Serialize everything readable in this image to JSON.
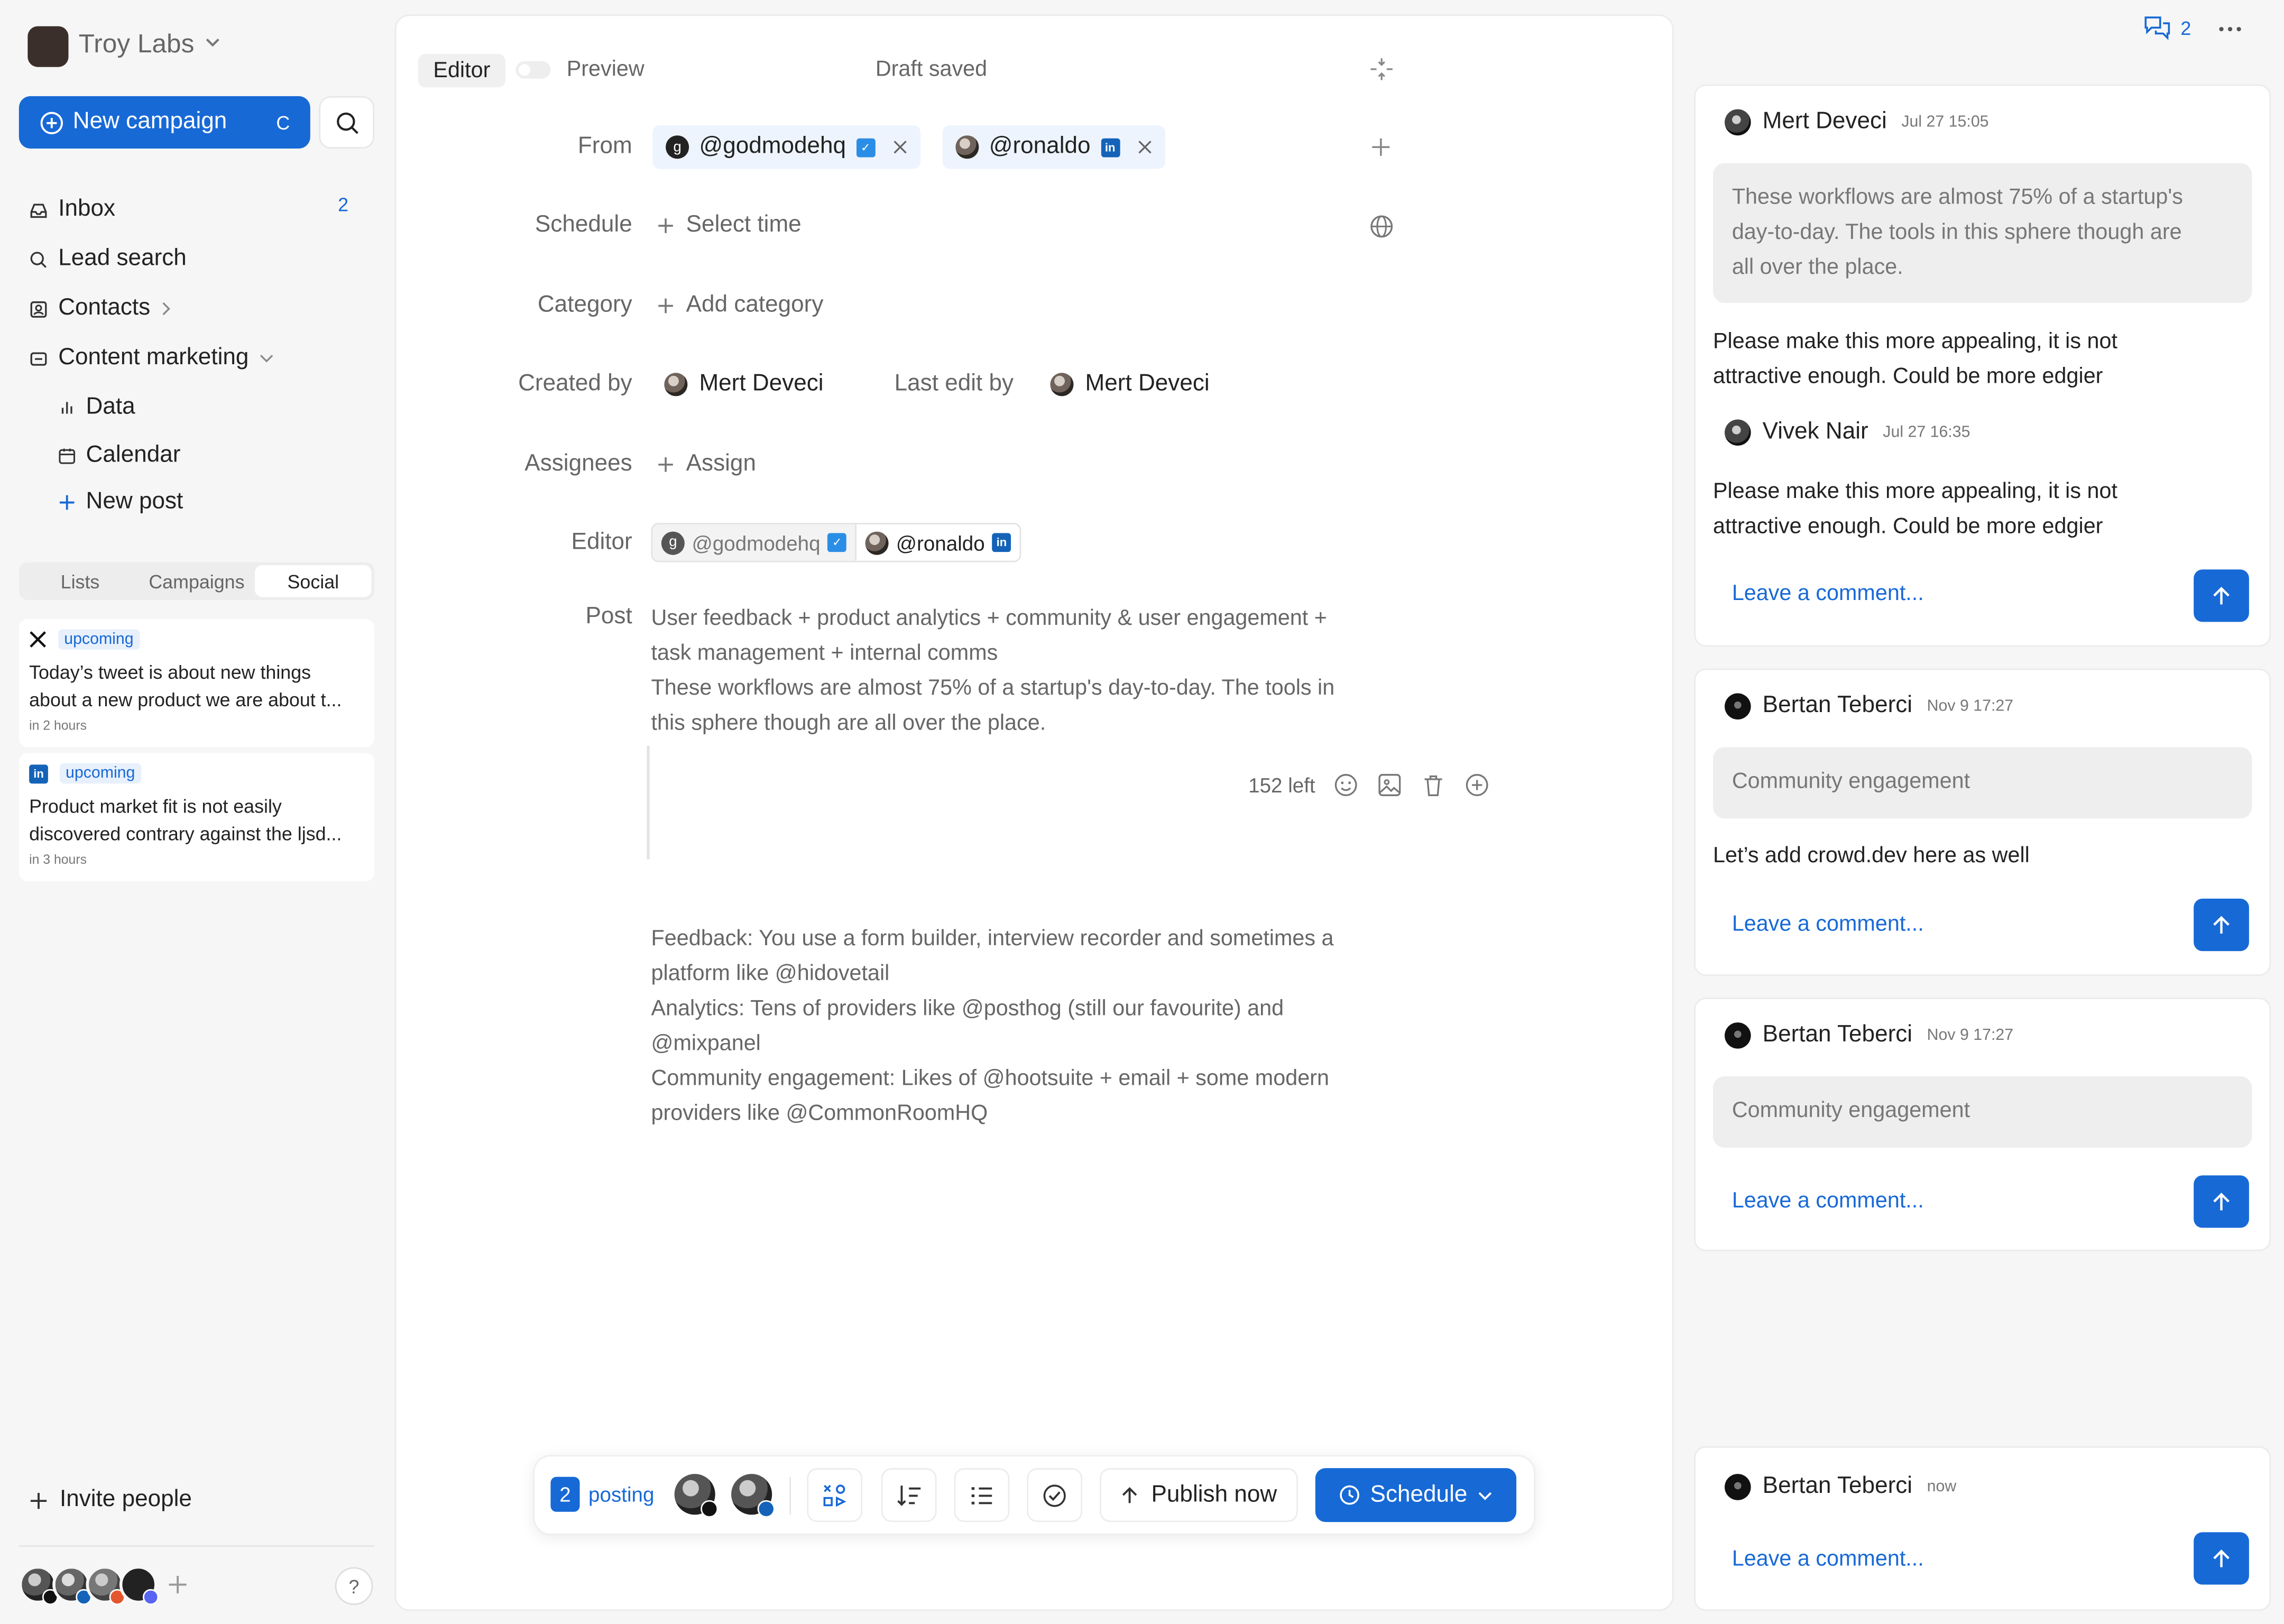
{
  "sidebar": {
    "workspace_name": "Troy Labs",
    "new_campaign_label": "New campaign",
    "new_campaign_shortcut": "C",
    "nav": {
      "inbox": "Inbox",
      "inbox_count": "2",
      "lead_search": "Lead search",
      "contacts": "Contacts",
      "content_marketing": "Content marketing",
      "data": "Data",
      "calendar": "Calendar",
      "new_post": "New post"
    },
    "tabs": [
      "Lists",
      "Campaigns",
      "Social"
    ],
    "active_tab": "Social",
    "feed": [
      {
        "network": "x",
        "status": "upcoming",
        "line1": "Today’s tweet is about new things",
        "line2": "about a new product we are about t...",
        "time": "in 2 hours"
      },
      {
        "network": "linkedin",
        "status": "upcoming",
        "line1": "Product market fit is not easily",
        "line2": "discovered contrary against the ljsd...",
        "time": "in 3 hours"
      }
    ],
    "invite_label": "Invite people",
    "help_label": "?"
  },
  "editor": {
    "tab_editor": "Editor",
    "tab_preview": "Preview",
    "draft_status": "Draft saved",
    "labels": {
      "from": "From",
      "schedule": "Schedule",
      "category": "Category",
      "created_by": "Created by",
      "last_edit_by": "Last edit by",
      "assignees": "Assignees",
      "editor": "Editor",
      "post": "Post"
    },
    "from_accounts": [
      {
        "handle": "@godmodehq",
        "network": "twitter",
        "avatar": "g"
      },
      {
        "handle": "@ronaldo",
        "network": "linkedin",
        "avatar": ""
      }
    ],
    "schedule_placeholder": "Select time",
    "category_placeholder": "Add category",
    "created_by": "Mert Deveci",
    "last_edit_by": "Mert Deveci",
    "assign_placeholder": "Assign",
    "editor_accounts": [
      {
        "handle": "@godmodehq",
        "network": "twitter",
        "active": false
      },
      {
        "handle": "@ronaldo",
        "network": "linkedin",
        "active": true
      }
    ],
    "post_intro": [
      "User feedback + product analytics + community & user engagement +",
      "task management + internal comms",
      "These workflows are almost 75% of a startup's day-to-day. The tools in",
      "this sphere though are all over the place."
    ],
    "chars_left": "152 left",
    "post_body": [
      "Feedback: You use a form builder, interview recorder and sometimes a",
      "platform like @hidovetail",
      "Analytics: Tens of providers like @posthog (still our favourite) and",
      "@mixpanel",
      "Community engagement: Likes of @hootsuite + email + some modern",
      "providers like @CommonRoomHQ"
    ]
  },
  "bottom_bar": {
    "posting_count": "2",
    "posting_label": "posting",
    "publish_label": "Publish now",
    "schedule_label": "Schedule"
  },
  "comments_header": {
    "count": "2"
  },
  "comments": [
    {
      "author": "Mert Deveci",
      "time": "Jul 27 15:05",
      "quote": [
        "These workflows are almost 75% of a startup's",
        "day-to-day. The tools in this sphere though are",
        "all over the place."
      ],
      "text": [
        "Please make this more appealing, it is not",
        "attractive enough. Could be more edgier"
      ],
      "reply_author": "Vivek Nair",
      "reply_time": "Jul 27 16:35",
      "reply_text": [
        "Please make this more appealing, it is not",
        "attractive enough. Could be more edgier"
      ],
      "placeholder": "Leave a comment..."
    },
    {
      "author": "Bertan Teberci",
      "time": "Nov 9 17:27",
      "quote": [
        "Community engagement"
      ],
      "text": [
        "Let’s add crowd.dev here as well"
      ],
      "placeholder": "Leave a comment..."
    },
    {
      "author": "Bertan Teberci",
      "time": "Nov 9 17:27",
      "quote": [
        "Community engagement"
      ],
      "placeholder": "Leave a comment..."
    },
    {
      "author": "Bertan Teberci",
      "time": "now",
      "placeholder": "Leave a comment..."
    }
  ],
  "colors": {
    "accent": "#1769d6",
    "twitter": "#2b8ee6",
    "linkedin": "#1463b8"
  }
}
